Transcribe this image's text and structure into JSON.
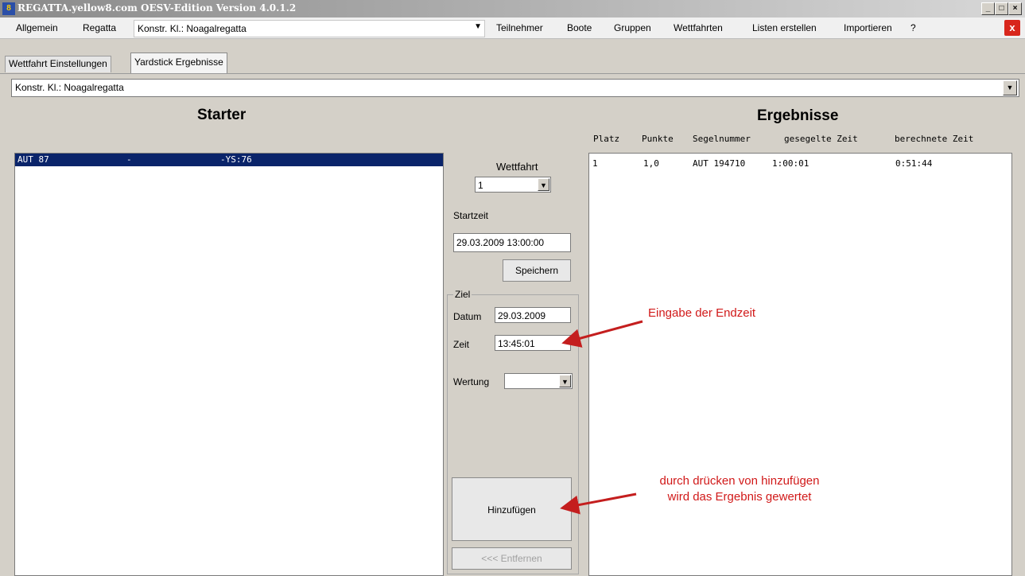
{
  "window": {
    "title": "REGATTA.yellow8.com OESV-Edition Version 4.0.1.2"
  },
  "menu": {
    "items": [
      "Allgemein",
      "Regatta"
    ],
    "class_select": "Konstr. Kl.:  Noagalregatta",
    "right_items": [
      "Teilnehmer",
      "Boote",
      "Gruppen",
      "Wettfahrten",
      "Listen erstellen",
      "Importieren",
      "?"
    ]
  },
  "tabs": [
    "Wettfahrt Einstellungen",
    "Yardstick Ergebnisse"
  ],
  "combo": {
    "value": "Konstr. Kl.:  Noagalregatta"
  },
  "starter": {
    "heading": "Starter",
    "rows": [
      {
        "sail": "AUT 87",
        "sep": "-",
        "ys": "-YS:76"
      }
    ]
  },
  "form": {
    "wettfahrt_label": "Wettfahrt",
    "wettfahrt_value": "1",
    "startzeit_label": "Startzeit",
    "startzeit_value": "29.03.2009 13:00:00",
    "save_button": "Speichern",
    "ziel_legend": "Ziel",
    "datum_label": "Datum",
    "datum_value": "29.03.2009",
    "zeit_label": "Zeit",
    "zeit_value": "13:45:01",
    "wertung_label": "Wertung",
    "wertung_value": "",
    "add_button": "Hinzufügen",
    "remove_button": "<<< Entfernen"
  },
  "results": {
    "heading": "Ergebnisse",
    "columns": [
      "Platz",
      "Punkte",
      "Segelnummer",
      "gesegelte Zeit",
      "berechnete Zeit"
    ],
    "rows": [
      {
        "platz": "1",
        "punkte": "1,0",
        "segelnummer": "AUT 194710",
        "gesegelt": "1:00:01",
        "berechnet": "0:51:44"
      }
    ]
  },
  "annotations": {
    "endzeit": "Eingabe der Endzeit",
    "add_line1": "durch drücken von hinzufügen",
    "add_line2": "wird das Ergebnis gewertet"
  },
  "colors": {
    "selection": "#0a246a",
    "annotation": "#d11919",
    "close": "#d8261c"
  }
}
